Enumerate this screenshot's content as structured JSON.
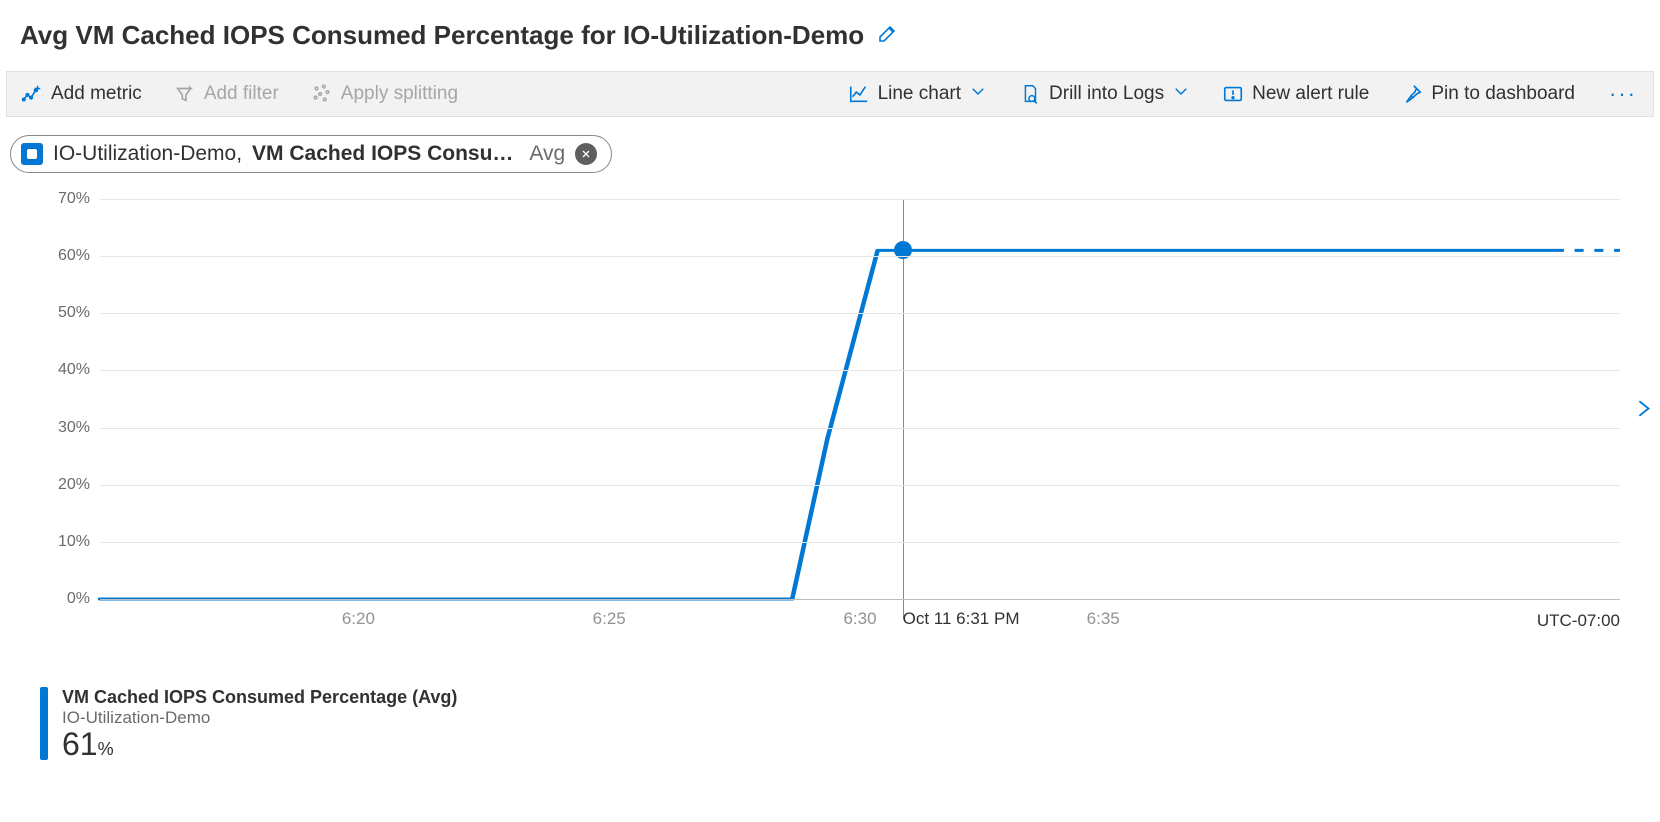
{
  "header": {
    "title": "Avg VM Cached IOPS Consumed Percentage for IO-Utilization-Demo"
  },
  "toolbar": {
    "add_metric": "Add metric",
    "add_filter": "Add filter",
    "apply_splitting": "Apply splitting",
    "chart_type": "Line chart",
    "drill_logs": "Drill into Logs",
    "new_alert": "New alert rule",
    "pin_dashboard": "Pin to dashboard"
  },
  "chip": {
    "resource": "IO-Utilization-Demo,",
    "metric": "VM Cached IOPS Consu…",
    "aggregation": "Avg"
  },
  "legend": {
    "line1": "VM Cached IOPS Consumed Percentage (Avg)",
    "line2": "IO-Utilization-Demo",
    "value": "61",
    "unit": "%"
  },
  "timezone": "UTC-07:00",
  "hover_label": "Oct 11 6:31 PM",
  "chart_data": {
    "type": "line",
    "title": "Avg VM Cached IOPS Consumed Percentage for IO-Utilization-Demo",
    "ylabel": "",
    "xlabel": "",
    "ylim": [
      0,
      70
    ],
    "y_ticks": [
      "0%",
      "10%",
      "20%",
      "30%",
      "40%",
      "50%",
      "60%",
      "70%"
    ],
    "x_tick_labels": [
      "6:20",
      "6:25",
      "6:30",
      "6:35"
    ],
    "x_tick_positions_pct": [
      17.0,
      33.5,
      50.0,
      66.0
    ],
    "x_range_minutes": [
      15,
      45.3
    ],
    "series": [
      {
        "name": "VM Cached IOPS Consumed Percentage (Avg)",
        "points": [
          {
            "x_min": 15.0,
            "y": 0
          },
          {
            "x_min": 28.8,
            "y": 0
          },
          {
            "x_min": 29.5,
            "y": 28
          },
          {
            "x_min": 30.5,
            "y": 61
          },
          {
            "x_min": 44.0,
            "y": 61
          }
        ],
        "projected_points": [
          {
            "x_min": 44.0,
            "y": 61
          },
          {
            "x_min": 45.3,
            "y": 61
          }
        ]
      }
    ],
    "crosshair_x_min": 31.0,
    "crosshair_y": 61,
    "colors": {
      "line": "#0078d4",
      "grid": "#e6e6e6"
    }
  }
}
